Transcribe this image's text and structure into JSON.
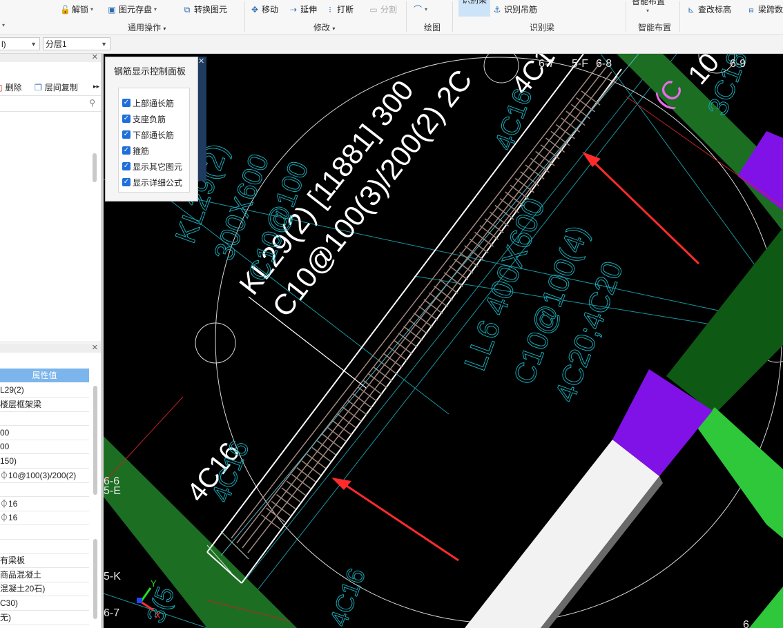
{
  "ribbon": {
    "unlock": "解锁",
    "save_element": "图元存盘",
    "convert_element": "转换图元",
    "move": "移动",
    "extend": "延伸",
    "break": "打断",
    "split": "分割",
    "recognize_beam": "识别梁",
    "recognize_hanger": "识别吊筋",
    "smart_layout_top": "智能布置",
    "check_elevation": "查改标高",
    "beam_span": "梁跨数",
    "groups": {
      "general": "通用操作",
      "modify": "修改",
      "draw": "绘图",
      "recognize_beam": "识别梁",
      "smart_layout": "智能布置"
    }
  },
  "toolbar2": {
    "floor_value": "l)",
    "layer_value": "分层1"
  },
  "left_panel": {
    "delete": "删除",
    "copy_between_floors": "层间复制"
  },
  "properties": {
    "header": "属性值",
    "rows": [
      "L29(2)",
      "楼层框架梁",
      "",
      "00",
      "00",
      "150)",
      "⏀10@100(3)/200(2)",
      "",
      "⏀16",
      "⏀16",
      "",
      "",
      "有梁板",
      "商品混凝土",
      "混凝土20石)",
      "C30)",
      "无)"
    ]
  },
  "rebar_panel": {
    "title": "钢筋显示控制面板",
    "options": [
      {
        "label": "上部通长筋",
        "checked": true
      },
      {
        "label": "支座负筋",
        "checked": true
      },
      {
        "label": "下部通长筋",
        "checked": true
      },
      {
        "label": "箍筋",
        "checked": true
      },
      {
        "label": "显示其它图元",
        "checked": true
      },
      {
        "label": "显示详细公式",
        "checked": true
      }
    ]
  },
  "cad": {
    "annotation_line1": "KL29(2) [11881] 300",
    "annotation_line2": "C10@100(3)/200(2) 2C",
    "rebar_top": "4C1",
    "rebar_bottom": "4C16",
    "rebar_dim_top": "4C16",
    "rebar_dim_bottom": "4C16",
    "cad_label_kl": "KL29(2)",
    "cad_label_size": "300X600",
    "cad_label_stirrup": "C10@100",
    "ll6_line1": "LL6 400X600",
    "ll6_line2": "C10@100(4)",
    "ll6_line3": "4C20;4C20",
    "axis_67": "6-7",
    "axis_5f": "5-F",
    "axis_68": "6-8",
    "axis_69": "6-9",
    "axis_66": "6-6",
    "axis_5e": "5-E",
    "axis_5k": "5-K",
    "axis_67b": "6-7",
    "axis_6": "6",
    "pink_text": "(C",
    "white_top_right": "10",
    "axis_y": "Y",
    "axis_x": "X",
    "right_fragment": "3C18",
    "bottom_fragment": "4C16",
    "left_fragment": "4C16",
    "left_fragment2": "3(5",
    "top_fragment": "4C16"
  }
}
